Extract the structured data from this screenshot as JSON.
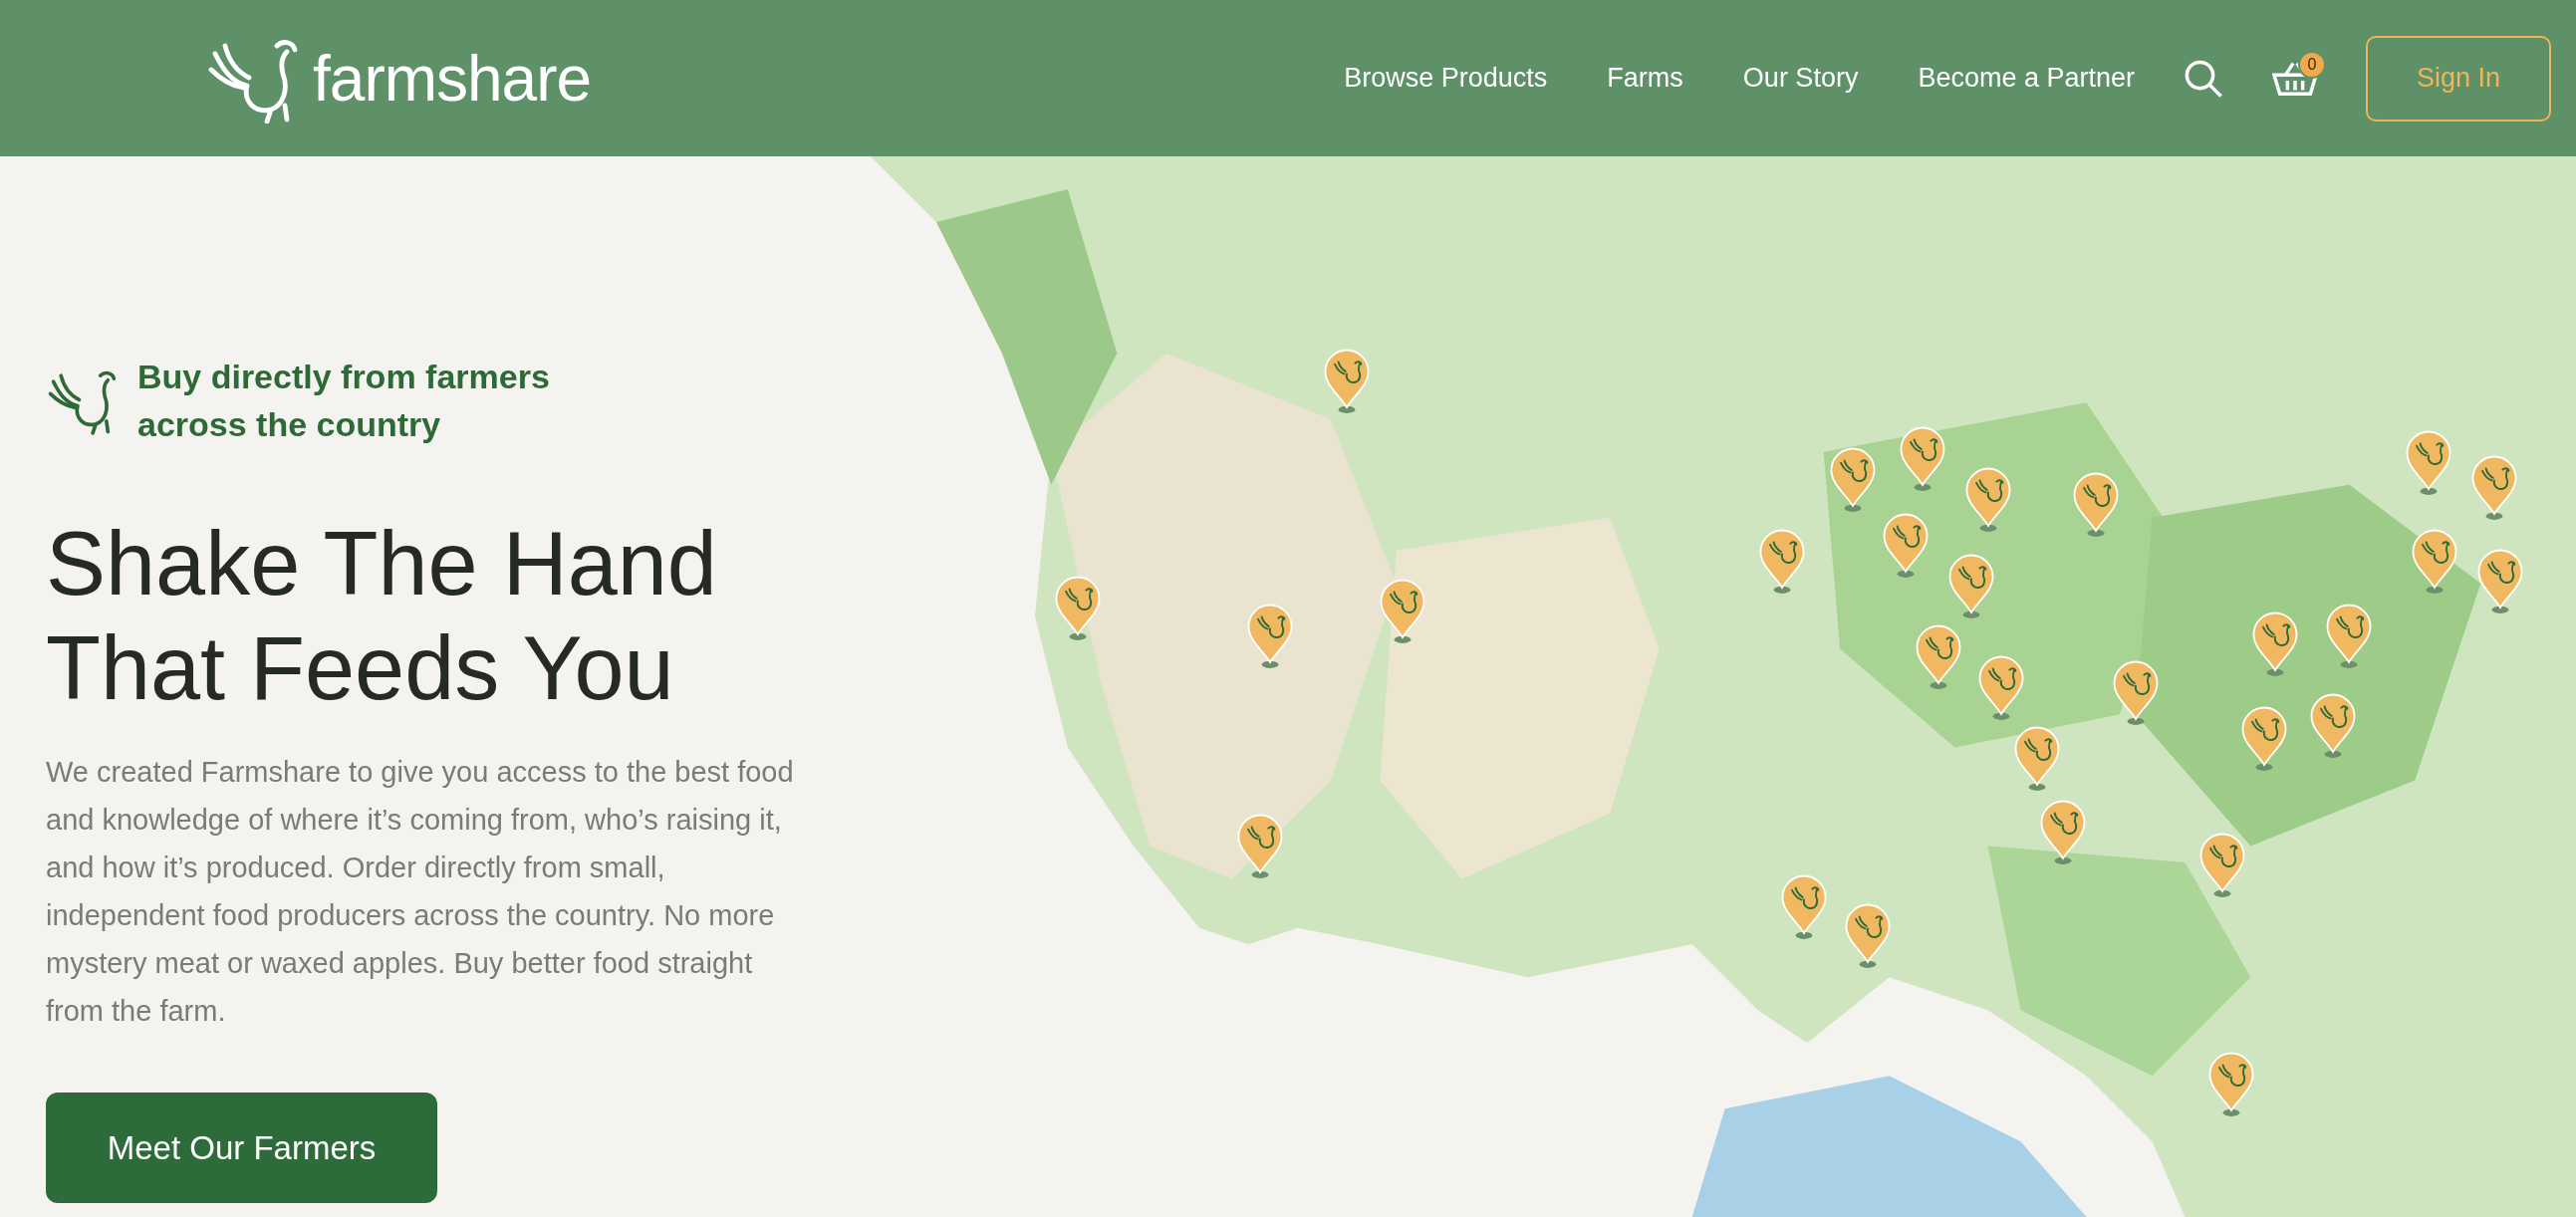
{
  "header": {
    "logo": "farmshare",
    "nav": [
      {
        "label": "Browse Products"
      },
      {
        "label": "Farms"
      },
      {
        "label": "Our Story"
      },
      {
        "label": "Become a Partner"
      }
    ],
    "cart_count": "0",
    "sign_in": "Sign In"
  },
  "hero": {
    "tagline": "Buy directly from farmers across the country",
    "title": "Shake The Hand That Feeds You",
    "body": "We created Farmshare to give you access to the best food and knowledge of where it’s coming from, who’s raising it, and how it’s produced. Order directly from small, independent food producers across the country. No more mystery meat or waxed apples. Buy better food straight from the farm.",
    "button": "Meet Our Farmers"
  }
}
